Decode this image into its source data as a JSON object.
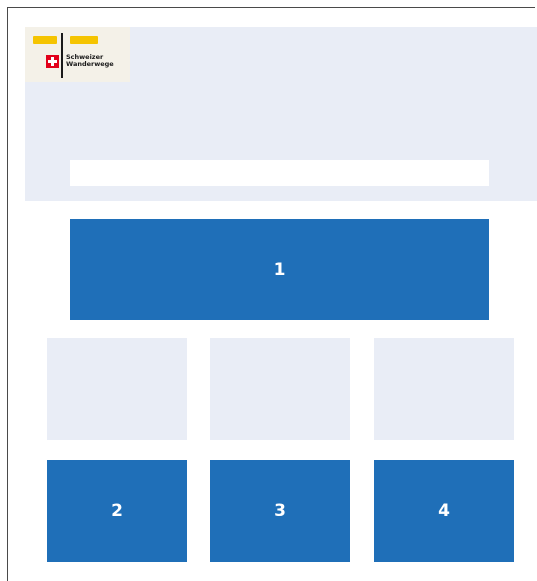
{
  "logo": {
    "line1": "Schweizer",
    "line2": "Wanderwege"
  },
  "search": {
    "placeholder": "",
    "value": ""
  },
  "tiles": {
    "primary": {
      "label": "1"
    },
    "secondary": [
      {
        "label": "2"
      },
      {
        "label": "3"
      },
      {
        "label": "4"
      }
    ]
  },
  "colors": {
    "accent_blue": "#1f6fb8",
    "panel_light": "#e9edf6",
    "swiss_red": "#e2001a",
    "sign_yellow": "#f5c400"
  }
}
